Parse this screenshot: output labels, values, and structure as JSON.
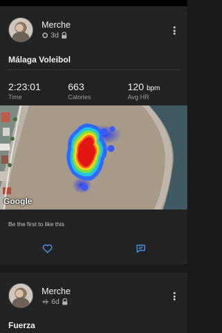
{
  "post1": {
    "user_name": "Merche",
    "time_ago": "3d",
    "privacy_icon": "lock-icon",
    "source_icon": "watch-icon",
    "activity_title": "Málaga Voleibol",
    "stats": [
      {
        "value": "2:23:01",
        "label": "Time"
      },
      {
        "value": "663",
        "label": "Calories"
      },
      {
        "value": "120",
        "unit": "bpm",
        "label": "Avg HR"
      }
    ],
    "map_brand": "Google",
    "likes_text": "Be the first to like this",
    "actions": {
      "like_icon": "heart-icon",
      "comment_icon": "comment-icon"
    }
  },
  "post2": {
    "user_name": "Merche",
    "time_ago": "6d",
    "source_icon": "plane-icon",
    "privacy_icon": "lock-icon",
    "activity_title": "Fuerza"
  },
  "colors": {
    "background": "#1a1a1a",
    "card": "#232323",
    "accent": "#4a90e2",
    "text_secondary": "#b3b3b3"
  }
}
